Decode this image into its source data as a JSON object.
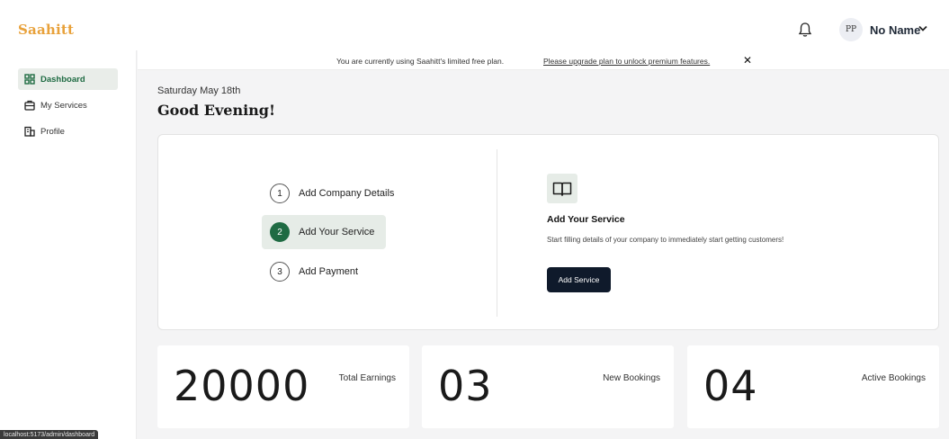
{
  "app": {
    "brand": "Saahitt"
  },
  "header": {
    "avatar_initials": "PP",
    "user_name": "No Name"
  },
  "sidebar": {
    "items": [
      {
        "label": "Dashboard",
        "icon": "grid-icon",
        "active": true
      },
      {
        "label": "My Services",
        "icon": "briefcase-icon",
        "active": false
      },
      {
        "label": "Profile",
        "icon": "building-icon",
        "active": false
      }
    ]
  },
  "banner": {
    "message": "You are currently using Saahitt's limited free plan.",
    "upgrade_link": "Please upgrade plan to unlock premium features."
  },
  "page": {
    "date": "Saturday May 18th",
    "greeting": "Good Evening!"
  },
  "onboarding": {
    "steps": [
      {
        "number": "1",
        "label": "Add Company Details",
        "active": false
      },
      {
        "number": "2",
        "label": "Add Your Service",
        "active": true
      },
      {
        "number": "3",
        "label": "Add Payment",
        "active": false
      }
    ],
    "detail": {
      "icon": "book-icon",
      "title": "Add Your Service",
      "description": "Start filling details of your company to immediately start getting customers!",
      "button_label": "Add Service"
    }
  },
  "stats": [
    {
      "value": "20000",
      "label": "Total Earnings"
    },
    {
      "value": "03",
      "label": "New Bookings"
    },
    {
      "value": "04",
      "label": "Active Bookings"
    }
  ],
  "status_bar": {
    "url": "localhost:5173/admin/dashboard"
  },
  "colors": {
    "accent": "#1f6b43",
    "brand": "#e8a13a",
    "button_dark": "#0f1a2b"
  }
}
